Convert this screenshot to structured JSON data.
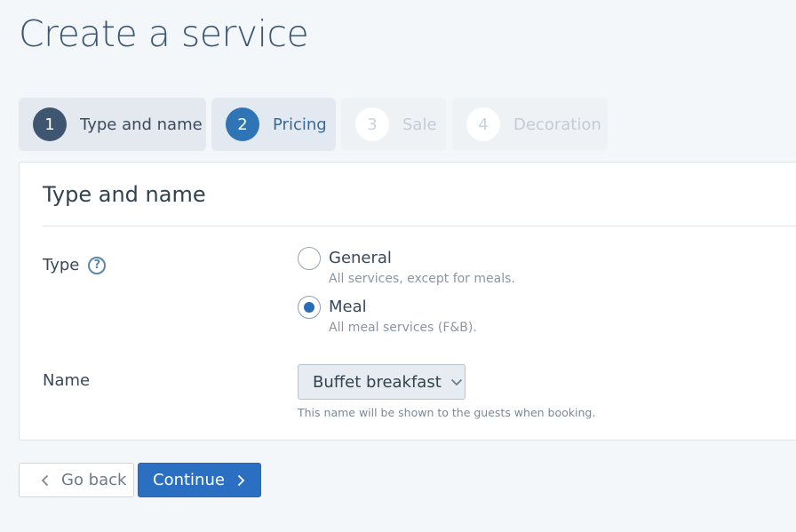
{
  "page": {
    "title": "Create a service"
  },
  "steps": [
    {
      "num": "1",
      "label": "Type and name",
      "state": "done"
    },
    {
      "num": "2",
      "label": "Pricing",
      "state": "active"
    },
    {
      "num": "3",
      "label": "Sale",
      "state": "disabled"
    },
    {
      "num": "4",
      "label": "Decoration",
      "state": "disabled"
    }
  ],
  "panel": {
    "title": "Type and name",
    "type_label": "Type",
    "help_icon": "question-circle-icon",
    "options": [
      {
        "title": "General",
        "description": "All services, except for meals.",
        "checked": false
      },
      {
        "title": "Meal",
        "description": "All meal services (F&B).",
        "checked": true
      }
    ],
    "name_label": "Name",
    "name_select": {
      "value": "Buffet breakfast"
    },
    "name_hint": "This name will be shown to the guests when booking."
  },
  "actions": {
    "back_label": "Go back",
    "continue_label": "Continue"
  },
  "colors": {
    "accent": "#2b6fc2",
    "step_done": "#3f5670",
    "step_active": "#2f74b5"
  }
}
